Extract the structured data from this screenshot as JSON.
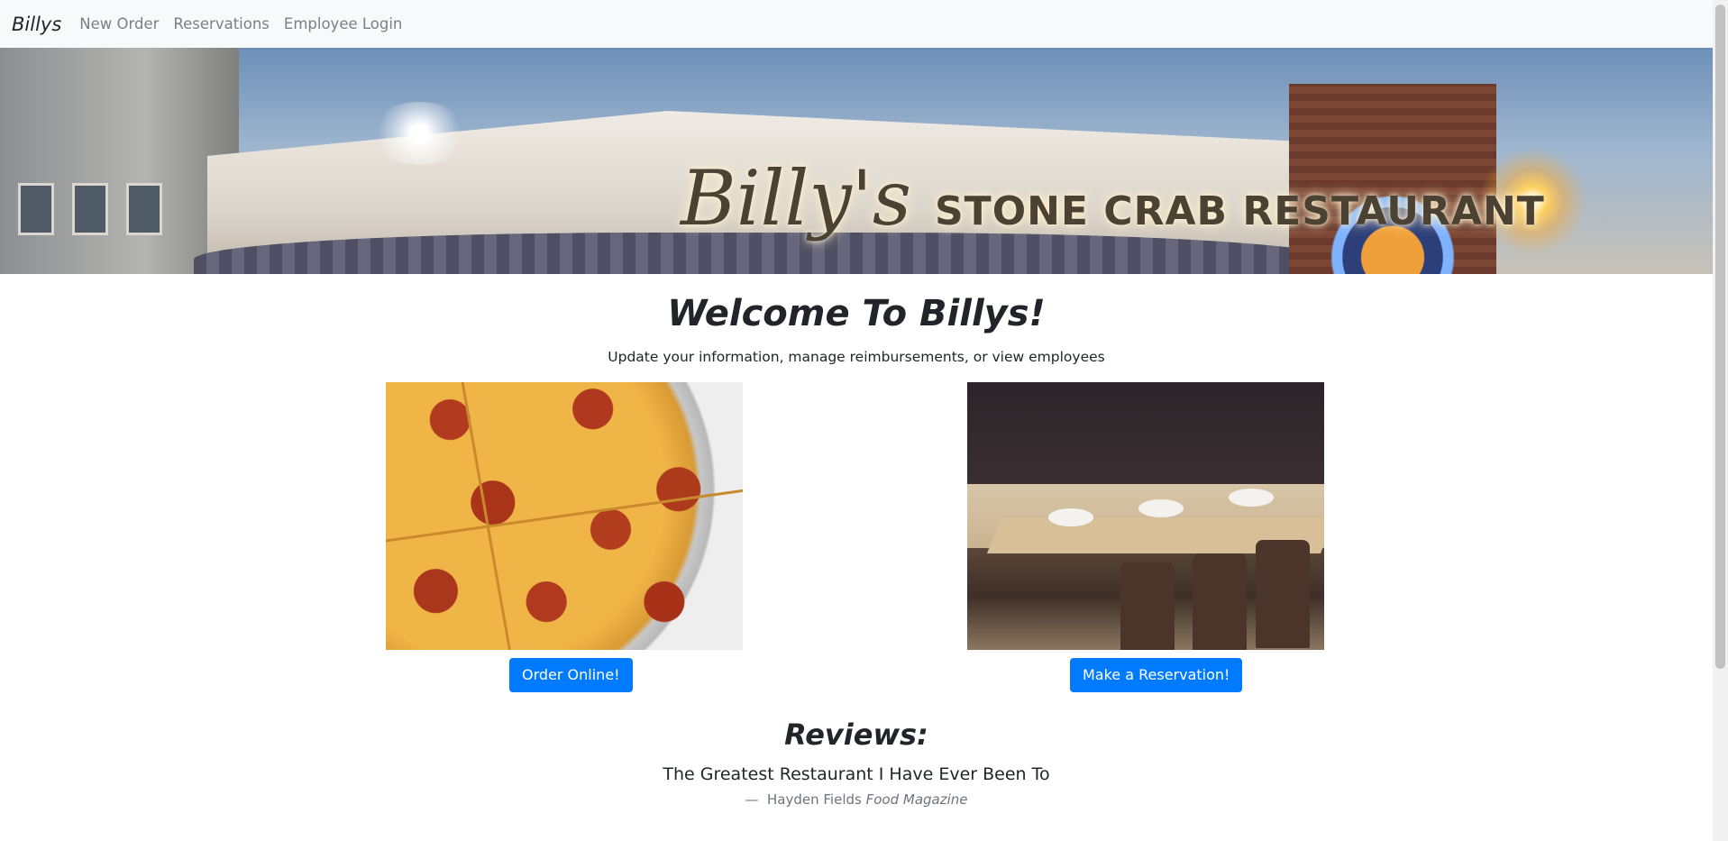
{
  "navbar": {
    "brand": "Billys",
    "links": [
      "New Order",
      "Reservations",
      "Employee Login"
    ]
  },
  "hero": {
    "sign_script": "Billy's",
    "sign_caps": "STONE CRAB RESTAURANT"
  },
  "welcome": {
    "title": "Welcome To Billys!",
    "subtitle": "Update your information, manage reimbursements, or view employees"
  },
  "cards": [
    {
      "button": "Order Online!"
    },
    {
      "button": "Make a Reservation!"
    }
  ],
  "reviews": {
    "heading": "Reviews:",
    "quote": "The Greatest Restaurant I Have Ever Been To",
    "dash": "—",
    "author": "Hayden Fields",
    "source": "Food Magazine"
  },
  "colors": {
    "primary": "#007bff",
    "navbar_bg": "#f8f9fa",
    "text": "#212529",
    "muted": "#6c757d"
  }
}
